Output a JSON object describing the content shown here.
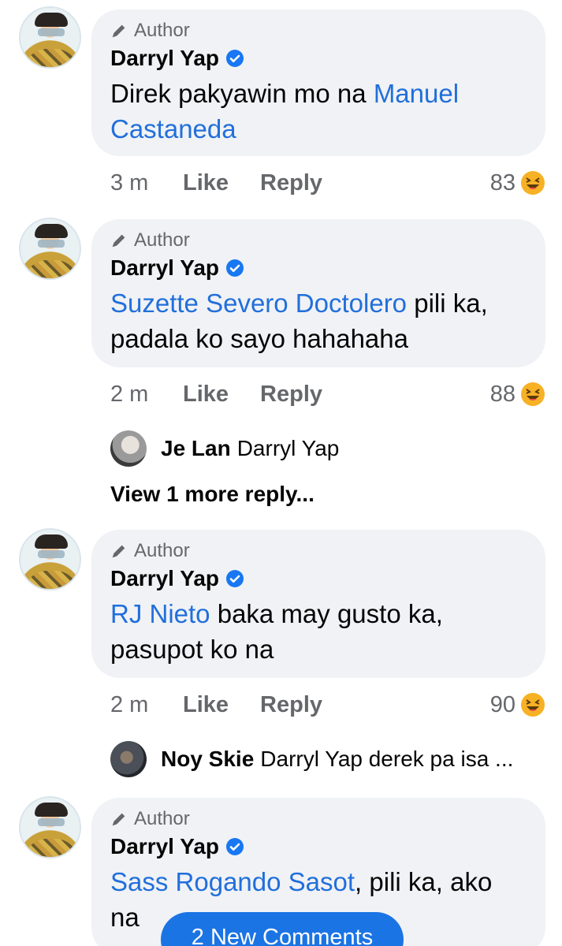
{
  "comments": [
    {
      "author_label": "Author",
      "name": "Darryl Yap",
      "mention": "Manuel\nCastaneda",
      "text_before": "Direk pakyawin mo na ",
      "text_after": "",
      "time": "3 m",
      "like": "Like",
      "reply": "Reply",
      "reaction_count": "83"
    },
    {
      "author_label": "Author",
      "name": "Darryl Yap",
      "mention": "Suzette Severo Doctolero",
      "text_before": "",
      "text_after": " pili ka, padala ko sayo hahahaha",
      "time": "2 m",
      "like": "Like",
      "reply": "Reply",
      "reaction_count": "88"
    },
    {
      "author_label": "Author",
      "name": "Darryl Yap",
      "mention": "RJ Nieto",
      "text_before": "",
      "text_after": " baka may gusto ka, pasupot ko na",
      "time": "2 m",
      "like": "Like",
      "reply": "Reply",
      "reaction_count": "90"
    },
    {
      "author_label": "Author",
      "name": "Darryl Yap",
      "mention": "Sass Rogando Sasot",
      "text_before": "",
      "text_after": ", pili ka, ako na",
      "time": "",
      "like": "",
      "reply": "",
      "reaction_count": ""
    }
  ],
  "replies": [
    {
      "name": "Je Lan",
      "text": "Darryl Yap"
    },
    {
      "name": "Noy Skie",
      "text": "Darryl Yap derek pa isa ..."
    }
  ],
  "view_more": "View 1 more reply...",
  "new_comments_button": "2 New Comments",
  "colors": {
    "bubble": "#f0f2f5",
    "link": "#216fdb",
    "secondary_text": "#65676b",
    "verified": "#1877f2",
    "button": "#1b74e4"
  },
  "icons": [
    "pencil-icon",
    "verified-badge-icon",
    "haha-reaction-icon"
  ]
}
